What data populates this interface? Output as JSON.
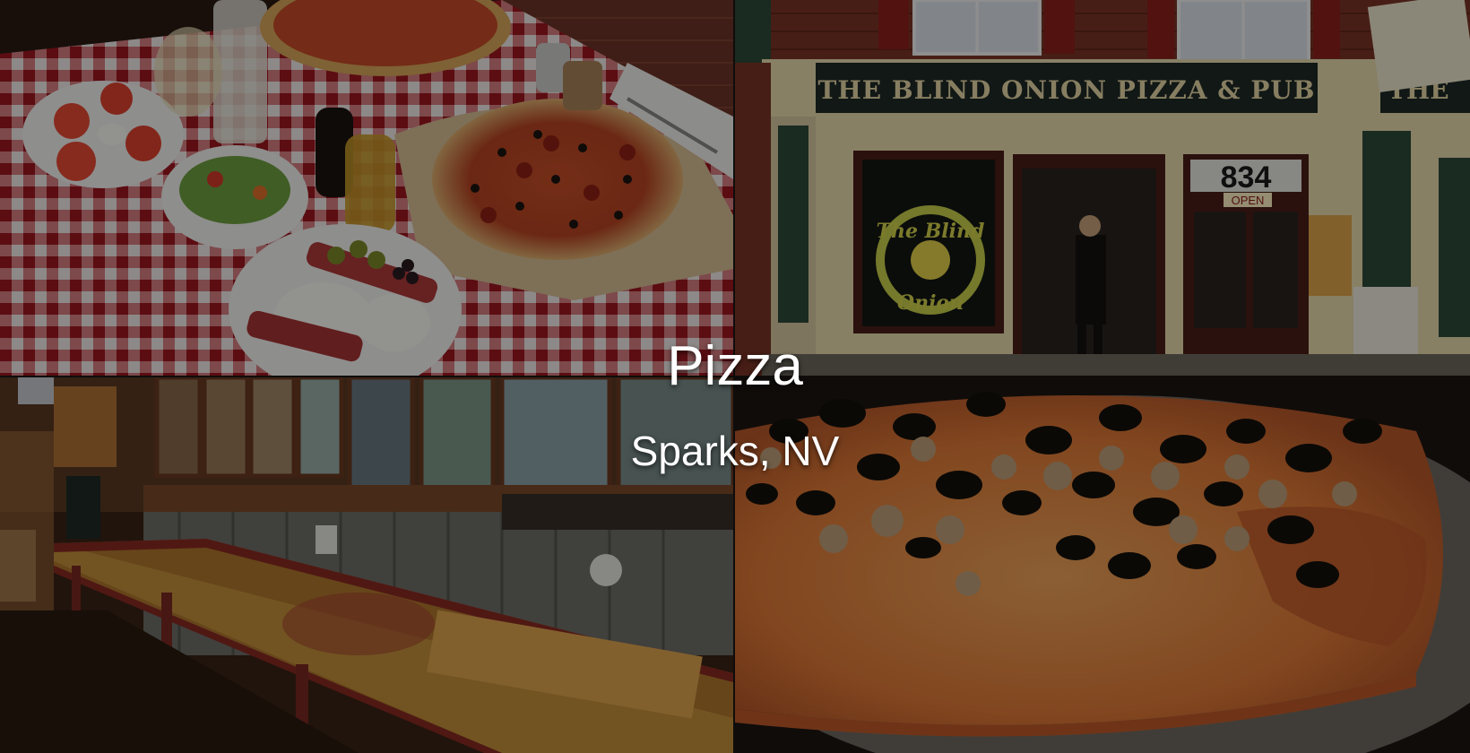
{
  "hero": {
    "title": "Pizza",
    "subtitle": "Sparks, NV"
  },
  "storefront": {
    "sign": "THE BLIND ONION PIZZA & PUB",
    "sign_partial": "THE",
    "address_number": "834",
    "open_sign": "OPEN",
    "logo_line1": "The Blind",
    "logo_line2": "Onion"
  },
  "colors": {
    "text": "#ffffff",
    "overlay": "#000000"
  }
}
